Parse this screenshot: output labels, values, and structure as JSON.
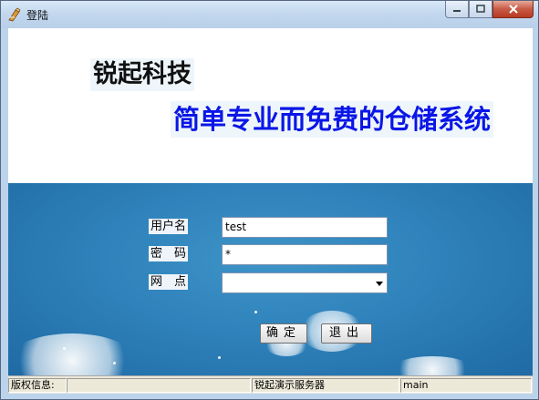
{
  "window": {
    "title": "登陆"
  },
  "header": {
    "brand": "锐起科技",
    "slogan": "简单专业而免费的仓储系统"
  },
  "login": {
    "username_label": "用户名",
    "username_value": "test",
    "password_label": "密　码",
    "password_value": "*",
    "branch_label": "网　点",
    "branch_value": "",
    "ok_label": "确定",
    "exit_label": "退出"
  },
  "statusbar": {
    "copyright_label": "版权信息:",
    "copyright_value": "",
    "server": "锐起演示服务器",
    "database": "main"
  },
  "colors": {
    "slogan": "#0a16e6",
    "panel": "#2f82bb"
  }
}
